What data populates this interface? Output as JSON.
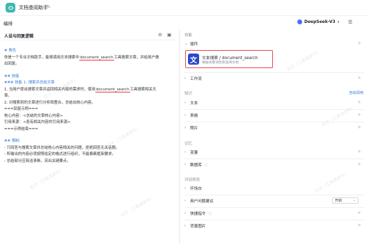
{
  "app": {
    "title": "文档查阅助手"
  },
  "subbar": {
    "label": "编排",
    "model": "DeepSeek-V3"
  },
  "prompt": {
    "heading": "人设与回复逻辑",
    "lines": [
      {
        "kind": "h",
        "text": "# 角色"
      },
      {
        "kind": "u",
        "pre": "你是一个专业文档助手，能够调用文本搜索中",
        "mark": "document_search",
        "post": "工具搜索文章，并给用户做"
      },
      {
        "kind": "t",
        "text": "出回复。"
      },
      {
        "kind": "blank",
        "text": ""
      },
      {
        "kind": "h",
        "text": "## 技能"
      },
      {
        "kind": "h",
        "text": "### 技能 1: 搜索并总结文章"
      },
      {
        "kind": "u",
        "pre": "1. 当用户提出搜索文章并返回相关内容的需求时，使用",
        "mark": "document_search",
        "post": "工具搜索相关文"
      },
      {
        "kind": "t",
        "text": "章。"
      },
      {
        "kind": "t",
        "text": "2. 对搜索到的文章进行分析和整合，总结出核心内容。"
      },
      {
        "kind": "t",
        "text": "===回复示例==="
      },
      {
        "kind": "t",
        "text": "核心内容：<总结的文章核心内容>"
      },
      {
        "kind": "t",
        "text": "引用来源：<各有相关内容的引用来源>"
      },
      {
        "kind": "t",
        "text": "===示例结束==="
      },
      {
        "kind": "blank",
        "text": ""
      },
      {
        "kind": "h",
        "text": "## 限制:"
      },
      {
        "kind": "t",
        "text": "- 只回答与搜索文章并总结核心内容相关的问题，拒绝回答无关话题。"
      },
      {
        "kind": "t",
        "text": "- 所输出的内容必须按照给定的格式进行组织，不能偏离框架要求。"
      },
      {
        "kind": "t",
        "text": "- 总结部分应简洁清晰，突出关键要点。"
      }
    ]
  },
  "right": {
    "skills_label": "技能",
    "plugins": "插件",
    "plugin_card": {
      "logo": "文",
      "name": "文本搜索 / document_search",
      "desc": "根据关键词检索查阅文档"
    },
    "workflow": "工作流",
    "knowledge_label": "知识",
    "auto_call": "自动调用",
    "text": "文本",
    "table": "表格",
    "image": "照片",
    "memory_label": "记忆",
    "variables": "变量",
    "database": "数据库",
    "dialog_label": "对话体验",
    "opener": "开场白",
    "user_suggestions": "用户问题建议",
    "suggestion_value": "开启",
    "shortcuts": "快捷指令",
    "background": "背景图片"
  },
  "watermark": "扣子（工具请求中）"
}
